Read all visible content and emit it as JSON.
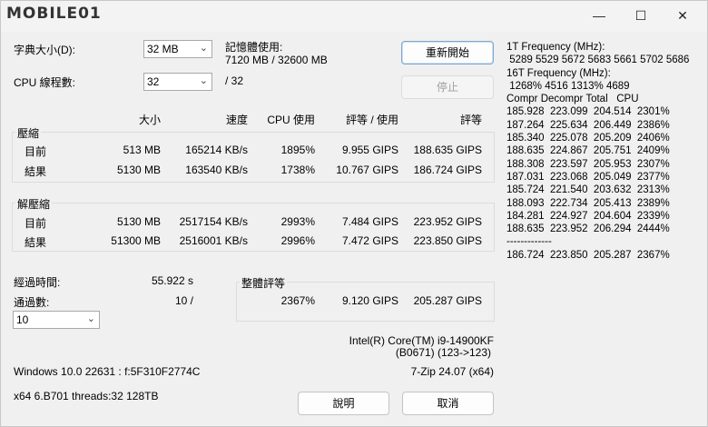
{
  "window": {
    "logo_text": "MOBILE01",
    "minimize": "—",
    "maximize": "☐",
    "close": "✕"
  },
  "settings": {
    "dict_label": "字典大小(D):",
    "dict_value": "32 MB",
    "threads_label": "CPU 線程數:",
    "threads_value": "32",
    "threads_total": "/ 32",
    "mem_label": "記憶體使用:",
    "mem_value": "7120 MB / 32600 MB"
  },
  "buttons": {
    "restart": "重新開始",
    "stop": "停止",
    "help": "說明",
    "cancel": "取消"
  },
  "headers": {
    "size": "大小",
    "speed": "速度",
    "cpu": "CPU 使用",
    "rating_usage": "評等 / 使用",
    "rating": "評等"
  },
  "compress": {
    "title": "壓縮",
    "current": {
      "label": "目前",
      "size": "513 MB",
      "speed": "165214 KB/s",
      "cpu": "1895%",
      "rating_usage": "9.955 GIPS",
      "rating": "188.635 GIPS"
    },
    "result": {
      "label": "結果",
      "size": "5130 MB",
      "speed": "163540 KB/s",
      "cpu": "1738%",
      "rating_usage": "10.767 GIPS",
      "rating": "186.724 GIPS"
    }
  },
  "decompress": {
    "title": "解壓縮",
    "current": {
      "label": "目前",
      "size": "5130 MB",
      "speed": "2517154 KB/s",
      "cpu": "2993%",
      "rating_usage": "7.484 GIPS",
      "rating": "223.952 GIPS"
    },
    "result": {
      "label": "結果",
      "size": "51300 MB",
      "speed": "2516001 KB/s",
      "cpu": "2996%",
      "rating_usage": "7.472 GIPS",
      "rating": "223.850 GIPS"
    }
  },
  "elapsed": {
    "label": "經過時間:",
    "value": "55.922 s",
    "passes_label": "通過數:",
    "passes_value": "10 /",
    "passes_select": "10"
  },
  "total": {
    "title": "整體評等",
    "cpu": "2367%",
    "rating_usage": "9.120 GIPS",
    "rating": "205.287 GIPS"
  },
  "system": {
    "cpu_name": "Intel(R) Core(TM) i9-14900KF",
    "cpu_id": "(B0671) (123->123)",
    "os": "Windows 10.0 22631 :  f:5F310F2774C",
    "version": "7-Zip 24.07 (x64)",
    "arch": "x64 6.B701 threads:32 128TB"
  },
  "rightpane": {
    "lines": [
      "1T Frequency (MHz):",
      " 5289 5529 5672 5683 5661 5702 5686",
      "16T Frequency (MHz):",
      " 1268% 4516 1313% 4689",
      "Compr Decompr Total   CPU",
      "185.928  223.099  204.514  2301%",
      "187.264  225.634  206.449  2386%",
      "185.340  225.078  205.209  2406%",
      "188.635  224.867  205.751  2409%",
      "188.308  223.597  205.953  2307%",
      "187.031  223.068  205.049  2377%",
      "185.724  221.540  203.632  2313%",
      "188.093  222.734  205.413  2389%",
      "184.281  224.927  204.604  2339%",
      "188.635  223.952  206.294  2444%",
      "-------------",
      "186.724  223.850  205.287  2367%"
    ]
  }
}
